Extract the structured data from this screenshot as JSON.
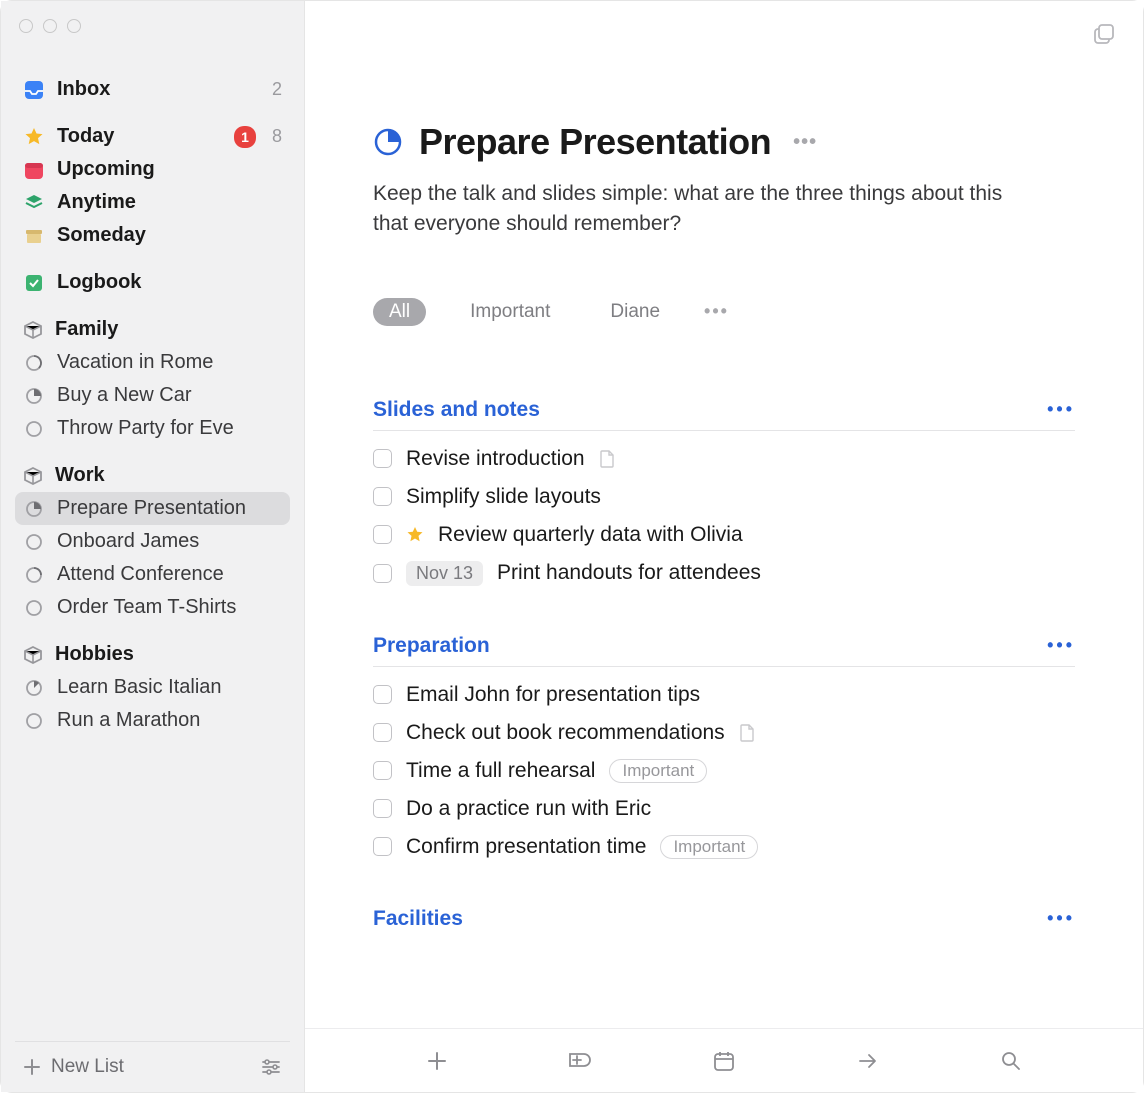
{
  "sidebar": {
    "inbox": {
      "label": "Inbox",
      "count": "2"
    },
    "today": {
      "label": "Today",
      "badge": "1",
      "count": "8"
    },
    "upcoming": {
      "label": "Upcoming"
    },
    "anytime": {
      "label": "Anytime"
    },
    "someday": {
      "label": "Someday"
    },
    "logbook": {
      "label": "Logbook"
    },
    "areas": [
      {
        "name": "Family",
        "projects": [
          {
            "label": "Vacation in Rome"
          },
          {
            "label": "Buy a New Car"
          },
          {
            "label": "Throw Party for Eve"
          }
        ]
      },
      {
        "name": "Work",
        "projects": [
          {
            "label": "Prepare Presentation",
            "selected": true
          },
          {
            "label": "Onboard James"
          },
          {
            "label": "Attend Conference"
          },
          {
            "label": "Order Team T-Shirts"
          }
        ]
      },
      {
        "name": "Hobbies",
        "projects": [
          {
            "label": "Learn Basic Italian"
          },
          {
            "label": "Run a Marathon"
          }
        ]
      }
    ],
    "new_list_label": "New List"
  },
  "main": {
    "title": "Prepare Presentation",
    "notes": "Keep the talk and slides simple: what are the three things about this that everyone should remember?",
    "filters": {
      "all": "All",
      "important": "Important",
      "diane": "Diane"
    },
    "sections": [
      {
        "title": "Slides and notes",
        "tasks": [
          {
            "text": "Revise introduction",
            "has_note": true
          },
          {
            "text": "Simplify slide layouts"
          },
          {
            "text": "Review quarterly data with Olivia",
            "starred": true
          },
          {
            "text": "Print handouts for attendees",
            "date": "Nov 13"
          }
        ]
      },
      {
        "title": "Preparation",
        "tasks": [
          {
            "text": "Email John for presentation tips"
          },
          {
            "text": "Check out book recommendations",
            "has_note": true
          },
          {
            "text": "Time a full rehearsal",
            "tag": "Important"
          },
          {
            "text": "Do a practice run with Eric"
          },
          {
            "text": "Confirm presentation time",
            "tag": "Important"
          }
        ]
      },
      {
        "title": "Facilities",
        "tasks": []
      }
    ]
  }
}
